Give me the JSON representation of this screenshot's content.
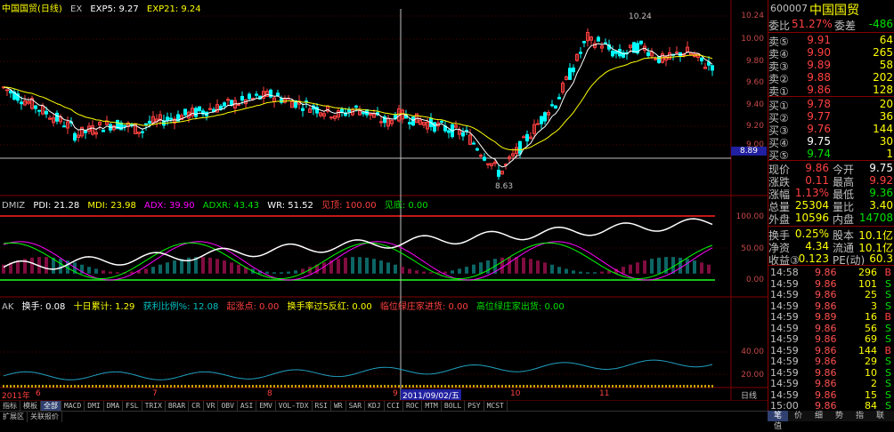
{
  "main_title": {
    "name": "中国国贸(日线)",
    "ex": "EX",
    "ma5": "EXP5: 9.27",
    "ma21": "EXP21: 9.24"
  },
  "price_axis": [
    "10.24",
    "10.00",
    "9.80",
    "9.60",
    "9.40",
    "9.20",
    "9.00",
    "8.89"
  ],
  "price_axis_labels": [
    "10.24",
    "10.00",
    "9.80",
    "9.60",
    "9.40",
    "9.20",
    "9.00"
  ],
  "current_price_tag": "8.89",
  "high_annot": "10.24",
  "low_annot": "8.63",
  "dmi_title": {
    "name": "DMIZ",
    "pdi": "PDI: 21.28",
    "mdi": "MDI: 23.98",
    "adx": "ADX: 39.90",
    "adxr": "ADXR: 43.43",
    "wr": "WR: 51.52",
    "top": "见顶: 100.00",
    "bottom": "见底: 0.00"
  },
  "dmi_axis": [
    "100.00",
    "50.00",
    "0.00"
  ],
  "ak_title": {
    "name": "AK",
    "turnover": "换手: 0.08",
    "tenday": "十日累计: 1.29",
    "profit": "获利比例%: 12.08",
    "start": "起涨点: 0.00",
    "reverse": "换手率过5反红: 0.00",
    "warn": "临位绿庄家进货: 0.00",
    "high_sell": "高位绿庄家出货: 0.00"
  },
  "ak_axis": [
    "40.00",
    "20.00"
  ],
  "date_axis": {
    "labels": [
      "2011年",
      "6",
      "7",
      "8",
      "9",
      "2011/09/02/五",
      "10",
      "11"
    ],
    "right": "日线"
  },
  "indicator_tabs": [
    "指标",
    "模板",
    "全部",
    "MACD",
    "DMI",
    "DMA",
    "FSL",
    "TRIX",
    "BRAR",
    "CR",
    "VR",
    "OBV",
    "ASI",
    "EMV",
    "VOL-TDX",
    "RSI",
    "WR",
    "SAR",
    "KDJ",
    "CCI",
    "ROC",
    "MTM",
    "BOLL",
    "PSY",
    "MCST"
  ],
  "bottom_tabs": [
    "扩展区",
    "关联报价"
  ],
  "panel": {
    "code": "600007",
    "name": "中国国贸",
    "weibi_label": "委比",
    "weibi": "51.27%",
    "weicha_label": "委差",
    "weicha": "-486",
    "asks": [
      {
        "label": "卖⑤",
        "price": "9.91",
        "vol": "64"
      },
      {
        "label": "卖④",
        "price": "9.90",
        "vol": "265"
      },
      {
        "label": "卖③",
        "price": "9.89",
        "vol": "58"
      },
      {
        "label": "卖②",
        "price": "9.88",
        "vol": "202"
      },
      {
        "label": "卖①",
        "price": "9.86",
        "vol": "128"
      }
    ],
    "bids": [
      {
        "label": "买①",
        "price": "9.78",
        "vol": "20"
      },
      {
        "label": "买②",
        "price": "9.77",
        "vol": "36"
      },
      {
        "label": "买③",
        "price": "9.76",
        "vol": "144"
      },
      {
        "label": "买④",
        "price": "9.75",
        "vol": "30"
      },
      {
        "label": "买⑤",
        "price": "9.74",
        "vol": "1"
      }
    ],
    "quote": [
      {
        "l1": "现价",
        "v1": "9.86",
        "l2": "今开",
        "v2": "9.75"
      },
      {
        "l1": "涨跌",
        "v1": "0.11",
        "l2": "最高",
        "v2": "9.92"
      },
      {
        "l1": "涨幅",
        "v1": "1.13%",
        "l2": "最低",
        "v2": "9.36"
      },
      {
        "l1": "总量",
        "v1": "25304",
        "l2": "量比",
        "v2": "3.40"
      },
      {
        "l1": "外盘",
        "v1": "10596",
        "l2": "内盘",
        "v2": "14708"
      }
    ],
    "finance": [
      {
        "l1": "换手",
        "v1": "0.25%",
        "l2": "股本",
        "v2": "10.1亿"
      },
      {
        "l1": "净资",
        "v1": "4.34",
        "l2": "流通",
        "v2": "10.1亿"
      },
      {
        "l1": "收益③",
        "v1": "0.123",
        "l2": "PE(动)",
        "v2": "60.3"
      }
    ],
    "ticks": [
      {
        "t": "14:58",
        "p": "9.86",
        "v": "296",
        "bs": "B"
      },
      {
        "t": "14:59",
        "p": "9.86",
        "v": "101",
        "bs": "S"
      },
      {
        "t": "14:59",
        "p": "9.86",
        "v": "25",
        "bs": "S"
      },
      {
        "t": "14:59",
        "p": "9.86",
        "v": "3",
        "bs": "S"
      },
      {
        "t": "14:59",
        "p": "9.89",
        "v": "16",
        "bs": "B"
      },
      {
        "t": "14:59",
        "p": "9.86",
        "v": "56",
        "bs": "S"
      },
      {
        "t": "14:59",
        "p": "9.86",
        "v": "69",
        "bs": "S"
      },
      {
        "t": "14:59",
        "p": "9.86",
        "v": "144",
        "bs": "B"
      },
      {
        "t": "14:59",
        "p": "9.86",
        "v": "29",
        "bs": "S"
      },
      {
        "t": "14:59",
        "p": "9.86",
        "v": "10",
        "bs": "S"
      },
      {
        "t": "14:59",
        "p": "9.86",
        "v": "2",
        "bs": "S"
      },
      {
        "t": "14:59",
        "p": "9.86",
        "v": "15",
        "bs": "S"
      },
      {
        "t": "15:00",
        "p": "9.86",
        "v": "84",
        "bs": "S"
      },
      {
        "t": "15:00",
        "p": "9.86",
        "v": "1",
        "bs": "S"
      }
    ],
    "tabs": [
      "笔",
      "价",
      "细",
      "势",
      "指",
      "联",
      "值"
    ]
  },
  "colors": {
    "up": "#ff4040",
    "down": "#00ffff",
    "ma5": "#ffffff",
    "ma21": "#ffff00",
    "pdi": "#ffffff",
    "mdi": "#ffff00",
    "adx": "#ff00ff",
    "adxr": "#00ff00",
    "grid": "#800000"
  }
}
